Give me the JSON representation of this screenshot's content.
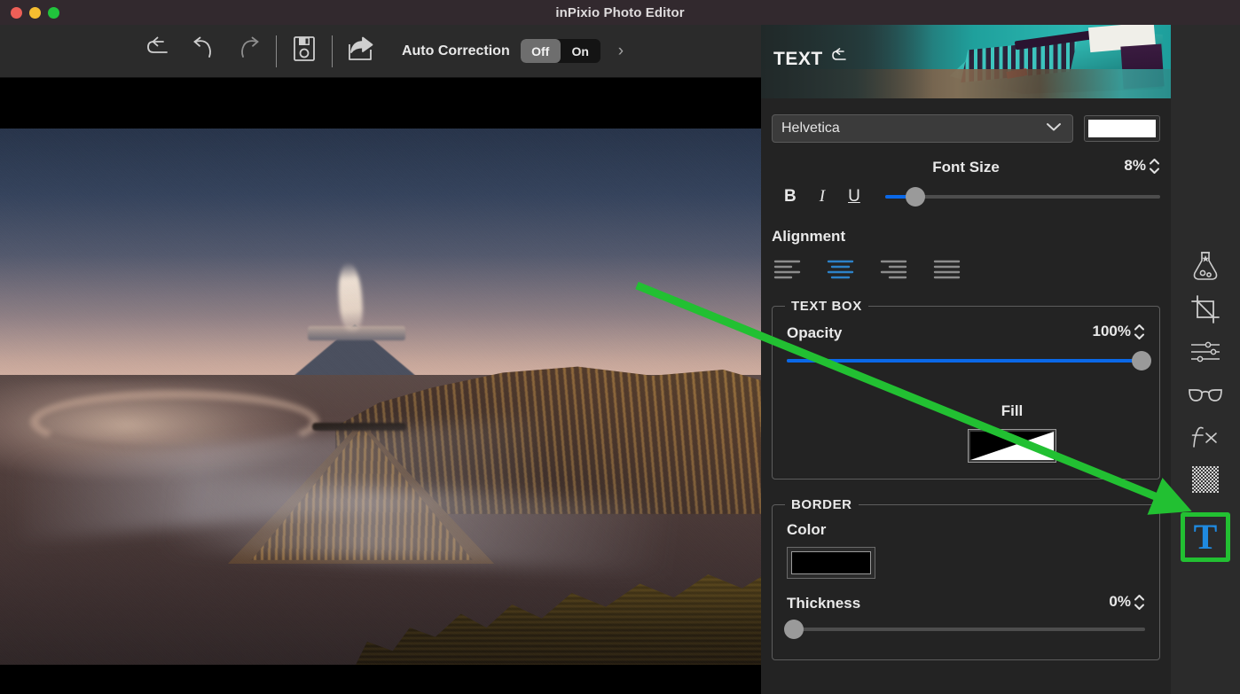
{
  "window": {
    "title": "inPixio Photo Editor",
    "traffic_lights": [
      "close",
      "minimize",
      "zoom"
    ]
  },
  "toolbar": {
    "icons": [
      {
        "name": "reset-icon",
        "label": "Reset"
      },
      {
        "name": "undo-icon",
        "label": "Undo"
      },
      {
        "name": "redo-icon",
        "label": "Redo"
      },
      {
        "name": "save-icon",
        "label": "Save"
      },
      {
        "name": "share-icon",
        "label": "Share"
      }
    ],
    "auto_correction_label": "Auto Correction",
    "toggle": {
      "off_label": "Off",
      "on_label": "On",
      "selected": "Off"
    },
    "expand_chevron": "›"
  },
  "canvas": {
    "photo_alt": "Mount Bromo volcano at sunrise with smoke plume"
  },
  "panel": {
    "banner": {
      "title": "TEXT",
      "reset_icon": "reset-icon"
    },
    "font": {
      "selected": "Helvetica",
      "dropdown_icon": "chevron-down-icon",
      "color_swatch": "#ffffff"
    },
    "font_size": {
      "label": "Font Size",
      "value": "8%",
      "percent": 8
    },
    "style": {
      "bold": "B",
      "italic": "I",
      "underline": "U"
    },
    "alignment": {
      "label": "Alignment",
      "options": [
        "align-left",
        "align-center",
        "align-right",
        "align-justify"
      ],
      "selected": "align-center",
      "active_color": "#2d82c8",
      "inactive_color": "#8c8c8c"
    },
    "text_box": {
      "legend": "TEXT BOX",
      "opacity": {
        "label": "Opacity",
        "value": "100%",
        "percent": 100
      },
      "fill": {
        "label": "Fill",
        "swatch": "black-white-gradient"
      }
    },
    "border": {
      "legend": "BORDER",
      "color": {
        "label": "Color",
        "swatch": "#000000"
      },
      "thickness": {
        "label": "Thickness",
        "value": "0%",
        "percent": 0
      }
    }
  },
  "rail": {
    "tools": [
      {
        "name": "magic-potion-icon",
        "label": "Magic"
      },
      {
        "name": "crop-icon",
        "label": "Crop"
      },
      {
        "name": "adjustments-icon",
        "label": "Adjustments"
      },
      {
        "name": "glasses-icon",
        "label": "Blur"
      },
      {
        "name": "fx-icon",
        "label": "Effects"
      },
      {
        "name": "texture-grid-icon",
        "label": "Texture"
      },
      {
        "name": "text-tool-icon",
        "label": "T"
      }
    ],
    "selected": "text-tool-icon",
    "highlight_color": "#22c032",
    "selected_icon_color": "#1f8ae0"
  },
  "annotation": {
    "arrow_color": "#22c032",
    "from": [
      718,
      322
    ],
    "to": [
      1332,
      572
    ]
  }
}
